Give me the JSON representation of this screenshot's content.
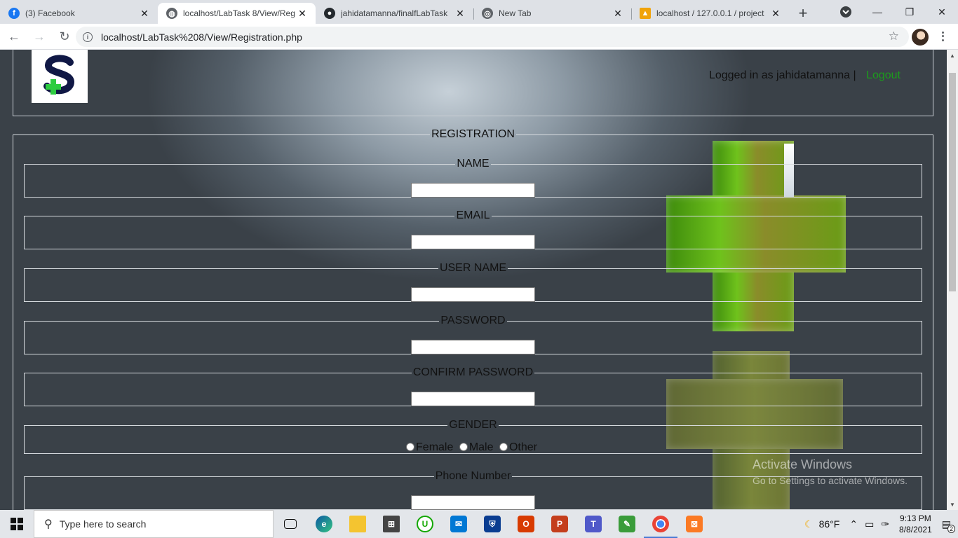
{
  "browser": {
    "tabs": [
      {
        "title": "(3) Facebook",
        "favicon": "facebook-icon",
        "color": "#1877f2",
        "active": false
      },
      {
        "title": "localhost/LabTask 8/View/Reg",
        "favicon": "globe-icon",
        "color": "#5f6368",
        "active": true
      },
      {
        "title": "jahidatamanna/finalfLabTask",
        "favicon": "github-icon",
        "color": "#24292e",
        "active": false
      },
      {
        "title": "New Tab",
        "favicon": "chrome-icon",
        "color": "#5f6368",
        "active": false
      },
      {
        "title": "localhost / 127.0.0.1 / project",
        "favicon": "phpmyadmin-icon",
        "color": "#f0a30a",
        "active": false
      }
    ],
    "url": "localhost/LabTask%208/View/Registration.php"
  },
  "header": {
    "logged_in_text": "Logged in as jahidatamanna |",
    "logout_label": "Logout"
  },
  "form": {
    "legend": "REGISTRATION",
    "fields": [
      {
        "label": "NAME",
        "value": ""
      },
      {
        "label": "EMAIL",
        "value": ""
      },
      {
        "label": "USER NAME",
        "value": ""
      },
      {
        "label": "PASSWORD",
        "value": ""
      },
      {
        "label": "CONFIRM PASSWORD",
        "value": ""
      }
    ],
    "gender": {
      "label": "GENDER",
      "options": [
        "Female",
        "Male",
        "Other"
      ]
    },
    "phone": {
      "label": "Phone Number",
      "value": ""
    }
  },
  "watermark": {
    "line1": "Activate Windows",
    "line2": "Go to Settings to activate Windows."
  },
  "taskbar": {
    "search_placeholder": "Type here to search",
    "weather": "86°F",
    "time": "9:13 PM",
    "date": "8/8/2021",
    "notification_count": "2"
  },
  "colors": {
    "logout": "#1c9c1c",
    "accent": "#1a73e8"
  }
}
